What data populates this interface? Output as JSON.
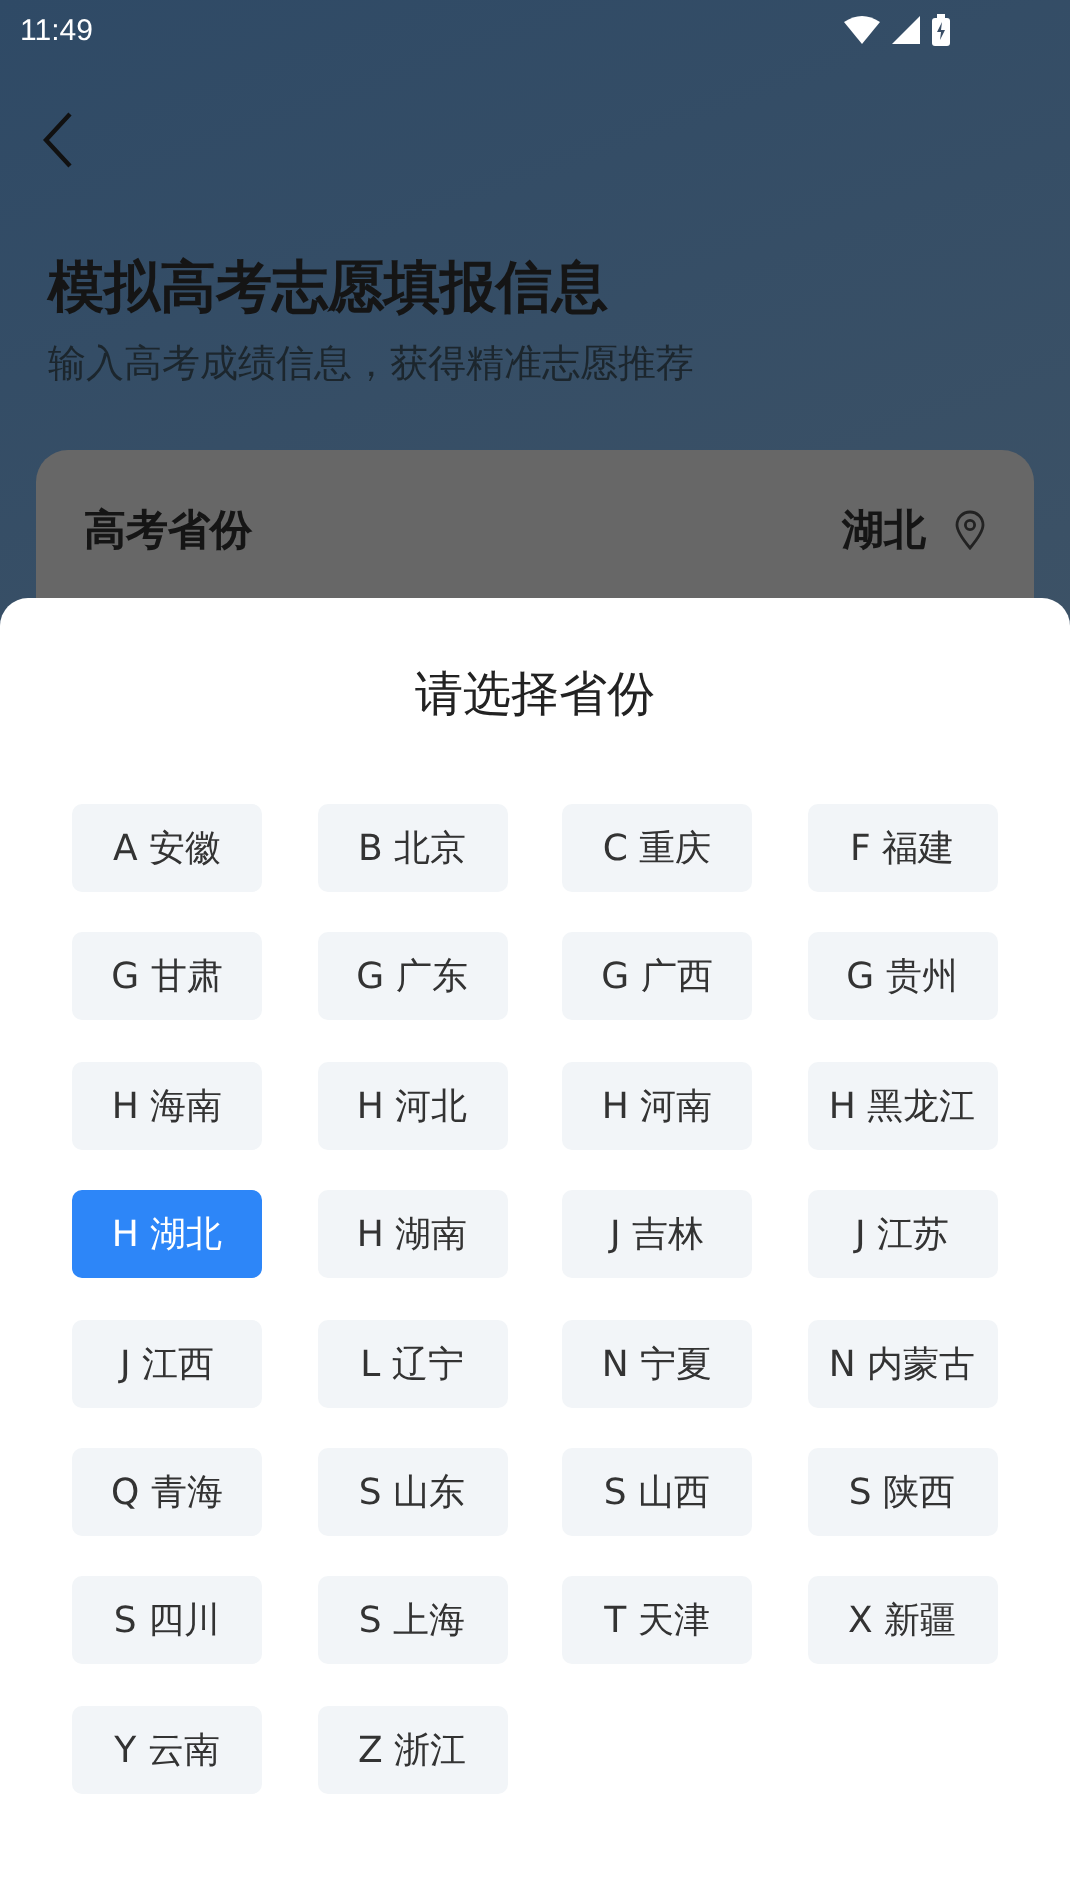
{
  "status_bar": {
    "time": "11:49"
  },
  "page": {
    "title": "模拟高考志愿填报信息",
    "subtitle": "输入高考成绩信息，获得精准志愿推荐",
    "field": {
      "label": "高考省份",
      "value": "湖北"
    }
  },
  "sheet": {
    "title": "请选择省份",
    "provinces": [
      {
        "label": "A 安徽",
        "selected": false
      },
      {
        "label": "B 北京",
        "selected": false
      },
      {
        "label": "C 重庆",
        "selected": false
      },
      {
        "label": "F 福建",
        "selected": false
      },
      {
        "label": "G 甘肃",
        "selected": false
      },
      {
        "label": "G 广东",
        "selected": false
      },
      {
        "label": "G 广西",
        "selected": false
      },
      {
        "label": "G 贵州",
        "selected": false
      },
      {
        "label": "H 海南",
        "selected": false
      },
      {
        "label": "H 河北",
        "selected": false
      },
      {
        "label": "H 河南",
        "selected": false
      },
      {
        "label": "H 黑龙江",
        "selected": false
      },
      {
        "label": "H 湖北",
        "selected": true
      },
      {
        "label": "H 湖南",
        "selected": false
      },
      {
        "label": "J 吉林",
        "selected": false
      },
      {
        "label": "J 江苏",
        "selected": false
      },
      {
        "label": "J 江西",
        "selected": false
      },
      {
        "label": "L 辽宁",
        "selected": false
      },
      {
        "label": "N 宁夏",
        "selected": false
      },
      {
        "label": "N 内蒙古",
        "selected": false
      },
      {
        "label": "Q 青海",
        "selected": false
      },
      {
        "label": "S 山东",
        "selected": false
      },
      {
        "label": "S 山西",
        "selected": false
      },
      {
        "label": "S 陕西",
        "selected": false
      },
      {
        "label": "S 四川",
        "selected": false
      },
      {
        "label": "S 上海",
        "selected": false
      },
      {
        "label": "T 天津",
        "selected": false
      },
      {
        "label": "X 新疆",
        "selected": false
      },
      {
        "label": "Y 云南",
        "selected": false
      },
      {
        "label": "Z 浙江",
        "selected": false
      }
    ]
  }
}
